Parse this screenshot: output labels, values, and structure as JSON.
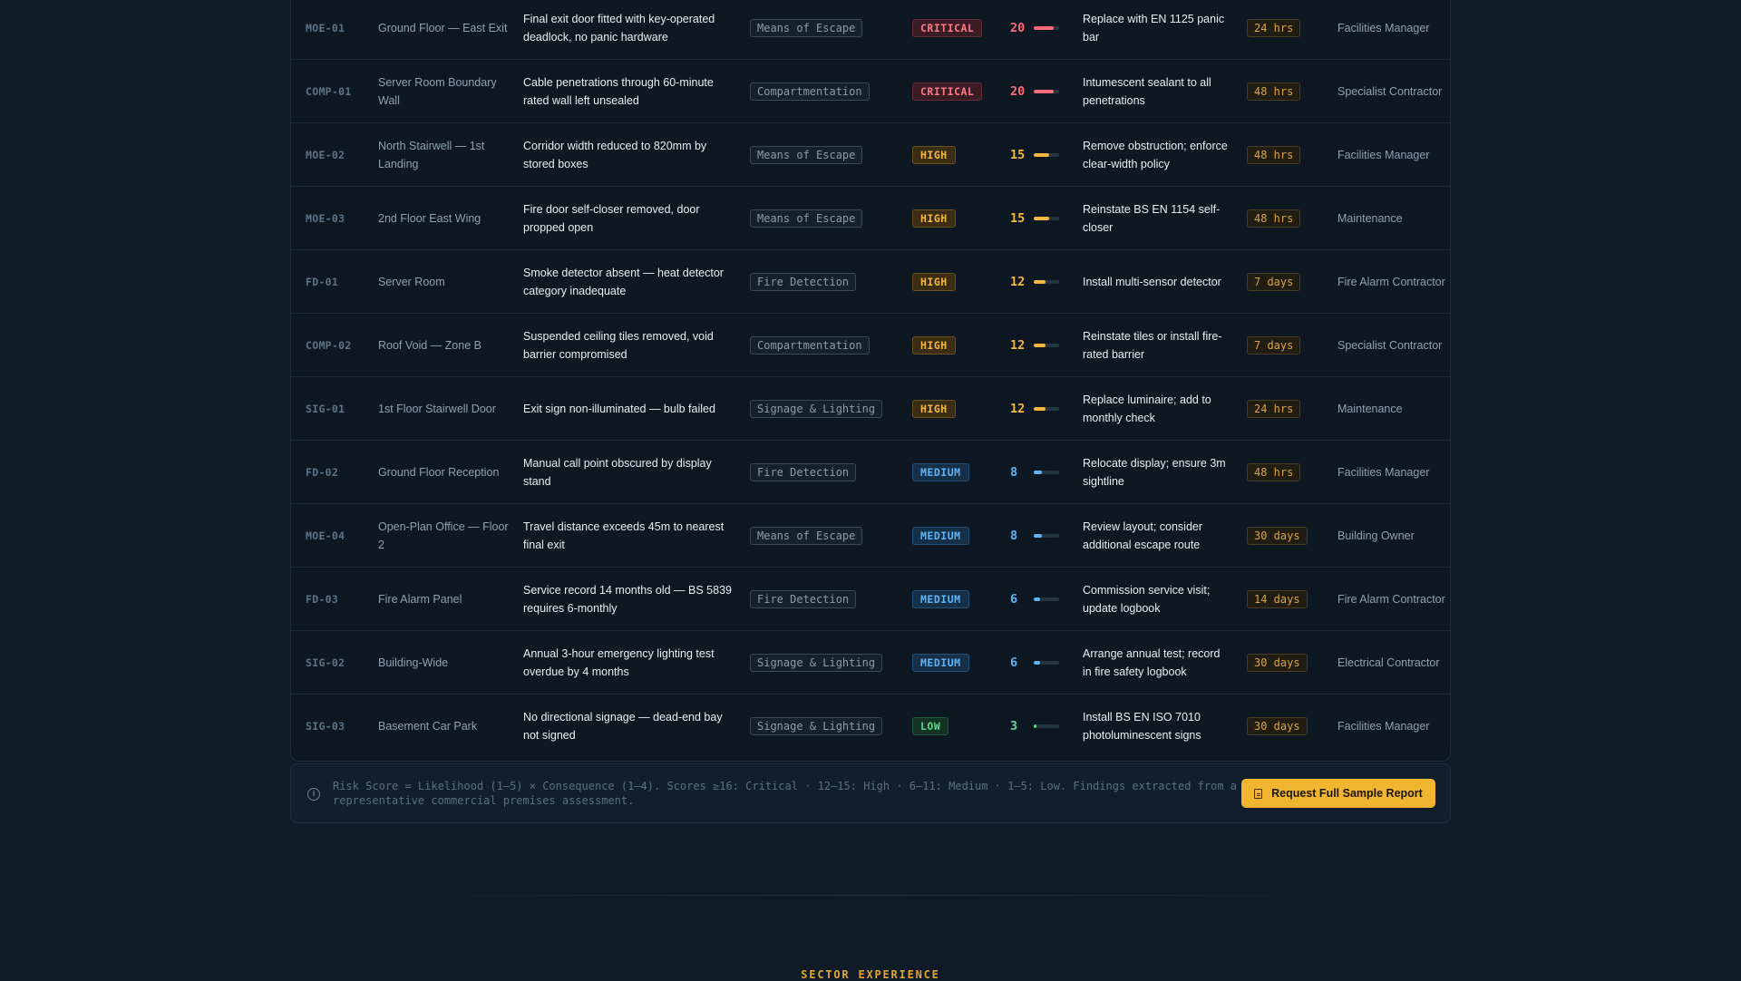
{
  "findings": [
    {
      "ref": "MOE-01",
      "location": "Ground Floor — East Exit",
      "finding": "Final exit door fitted with key-operated deadlock, no panic hardware",
      "category": "Means of Escape",
      "severity": "CRITICAL",
      "score": 20,
      "action": "Replace with EN 1125 panic bar",
      "timeframe": "24 hrs",
      "owner": "Facilities Manager"
    },
    {
      "ref": "COMP-01",
      "location": "Server Room Boundary Wall",
      "finding": "Cable penetrations through 60-minute rated wall left unsealed",
      "category": "Compartmentation",
      "severity": "CRITICAL",
      "score": 20,
      "action": "Intumescent sealant to all penetrations",
      "timeframe": "48 hrs",
      "owner": "Specialist Contractor"
    },
    {
      "ref": "MOE-02",
      "location": "North Stairwell — 1st Landing",
      "finding": "Corridor width reduced to 820mm by stored boxes",
      "category": "Means of Escape",
      "severity": "HIGH",
      "score": 15,
      "action": "Remove obstruction; enforce clear-width policy",
      "timeframe": "48 hrs",
      "owner": "Facilities Manager"
    },
    {
      "ref": "MOE-03",
      "location": "2nd Floor East Wing",
      "finding": "Fire door self-closer removed, door propped open",
      "category": "Means of Escape",
      "severity": "HIGH",
      "score": 15,
      "action": "Reinstate BS EN 1154 self-closer",
      "timeframe": "48 hrs",
      "owner": "Maintenance"
    },
    {
      "ref": "FD-01",
      "location": "Server Room",
      "finding": "Smoke detector absent — heat detector category inadequate",
      "category": "Fire Detection",
      "severity": "HIGH",
      "score": 12,
      "action": "Install multi-sensor detector",
      "timeframe": "7 days",
      "owner": "Fire Alarm Contractor"
    },
    {
      "ref": "COMP-02",
      "location": "Roof Void — Zone B",
      "finding": "Suspended ceiling tiles removed, void barrier compromised",
      "category": "Compartmentation",
      "severity": "HIGH",
      "score": 12,
      "action": "Reinstate tiles or install fire-rated barrier",
      "timeframe": "7 days",
      "owner": "Specialist Contractor"
    },
    {
      "ref": "SIG-01",
      "location": "1st Floor Stairwell Door",
      "finding": "Exit sign non-illuminated — bulb failed",
      "category": "Signage & Lighting",
      "severity": "HIGH",
      "score": 12,
      "action": "Replace luminaire; add to monthly check",
      "timeframe": "24 hrs",
      "owner": "Maintenance"
    },
    {
      "ref": "FD-02",
      "location": "Ground Floor Reception",
      "finding": "Manual call point obscured by display stand",
      "category": "Fire Detection",
      "severity": "MEDIUM",
      "score": 8,
      "action": "Relocate display; ensure 3m sightline",
      "timeframe": "48 hrs",
      "owner": "Facilities Manager"
    },
    {
      "ref": "MOE-04",
      "location": "Open-Plan Office — Floor 2",
      "finding": "Travel distance exceeds 45m to nearest final exit",
      "category": "Means of Escape",
      "severity": "MEDIUM",
      "score": 8,
      "action": "Review layout; consider additional escape route",
      "timeframe": "30 days",
      "owner": "Building Owner"
    },
    {
      "ref": "FD-03",
      "location": "Fire Alarm Panel",
      "finding": "Service record 14 months old — BS 5839 requires 6-monthly",
      "category": "Fire Detection",
      "severity": "MEDIUM",
      "score": 6,
      "action": "Commission service visit; update logbook",
      "timeframe": "14 days",
      "owner": "Fire Alarm Contractor"
    },
    {
      "ref": "SIG-02",
      "location": "Building-Wide",
      "finding": "Annual 3-hour emergency lighting test overdue by 4 months",
      "category": "Signage & Lighting",
      "severity": "MEDIUM",
      "score": 6,
      "action": "Arrange annual test; record in fire safety logbook",
      "timeframe": "30 days",
      "owner": "Electrical Contractor"
    },
    {
      "ref": "SIG-03",
      "location": "Basement Car Park",
      "finding": "No directional signage — dead-end bay not signed",
      "category": "Signage & Lighting",
      "severity": "LOW",
      "score": 3,
      "action": "Install BS EN ISO 7010 photoluminescent signs",
      "timeframe": "30 days",
      "owner": "Facilities Manager"
    }
  ],
  "score_max": 25,
  "severity_colors": {
    "CRITICAL": "#ff6b7a",
    "HIGH": "#f5b740",
    "MEDIUM": "#5fb4f5",
    "LOW": "#5fd88a"
  },
  "notice": {
    "icon": "info-icon",
    "text": "Risk Score = Likelihood (1–5) × Consequence (1–4). Scores ≥16: Critical · 12–15: High · 6–11: Medium · 1–5: Low. Findings extracted from a representative commercial premises assessment.",
    "button_label": "Request Full Sample Report",
    "button_icon": "document-icon"
  },
  "next_section_label": "SECTOR EXPERIENCE"
}
